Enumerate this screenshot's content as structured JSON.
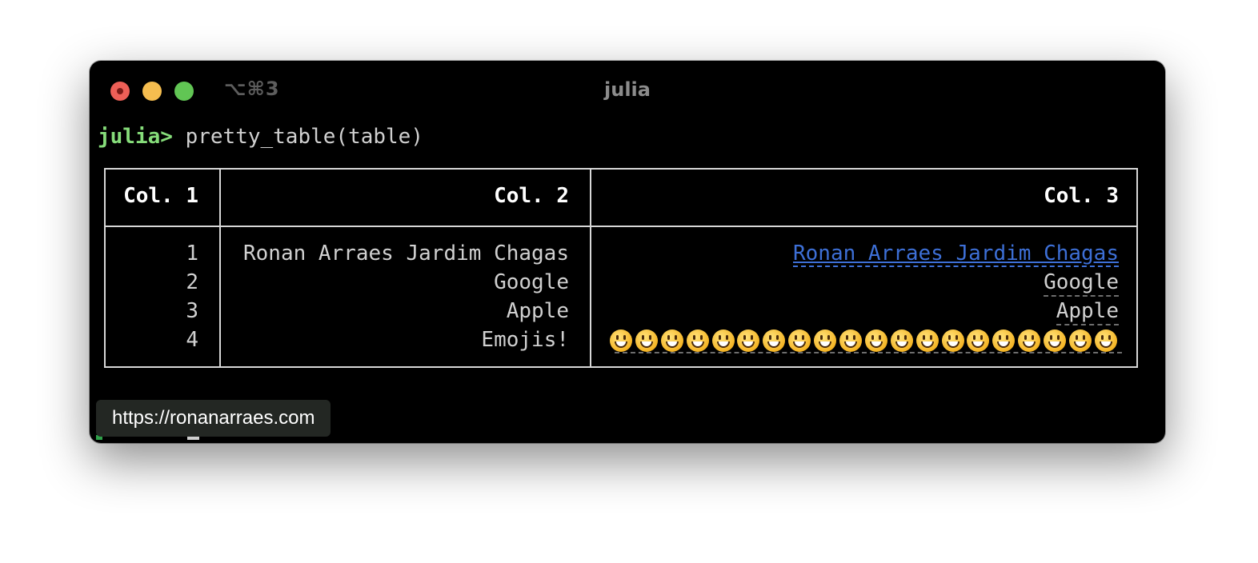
{
  "window": {
    "title": "julia",
    "shortcut": "⌥⌘3",
    "traffic_lights": {
      "close": "#ed5f57",
      "minimize": "#f5bd4f",
      "zoom": "#61c554"
    }
  },
  "terminal": {
    "prompt": "julia>",
    "command": "pretty_table(table)",
    "colors": {
      "prompt": "#86dd7a",
      "text": "#d0d0d0",
      "link": "#3d6fd6",
      "background": "#000000"
    }
  },
  "table": {
    "headers": [
      "Col. 1",
      "Col. 2",
      "Col. 3"
    ],
    "rows": [
      {
        "col1": "1",
        "col2": "Ronan Arraes Jardim Chagas",
        "col3": "Ronan Arraes Jardim Chagas"
      },
      {
        "col1": "2",
        "col2": "Google",
        "col3": "Google"
      },
      {
        "col1": "3",
        "col2": "Apple",
        "col3": "Apple"
      },
      {
        "col1": "4",
        "col2": "Emojis!",
        "col3_icon": "grinning-face-emoji",
        "col3_icon_count": 20
      }
    ]
  },
  "tooltip": {
    "url": "https://ronanarraes.com"
  }
}
